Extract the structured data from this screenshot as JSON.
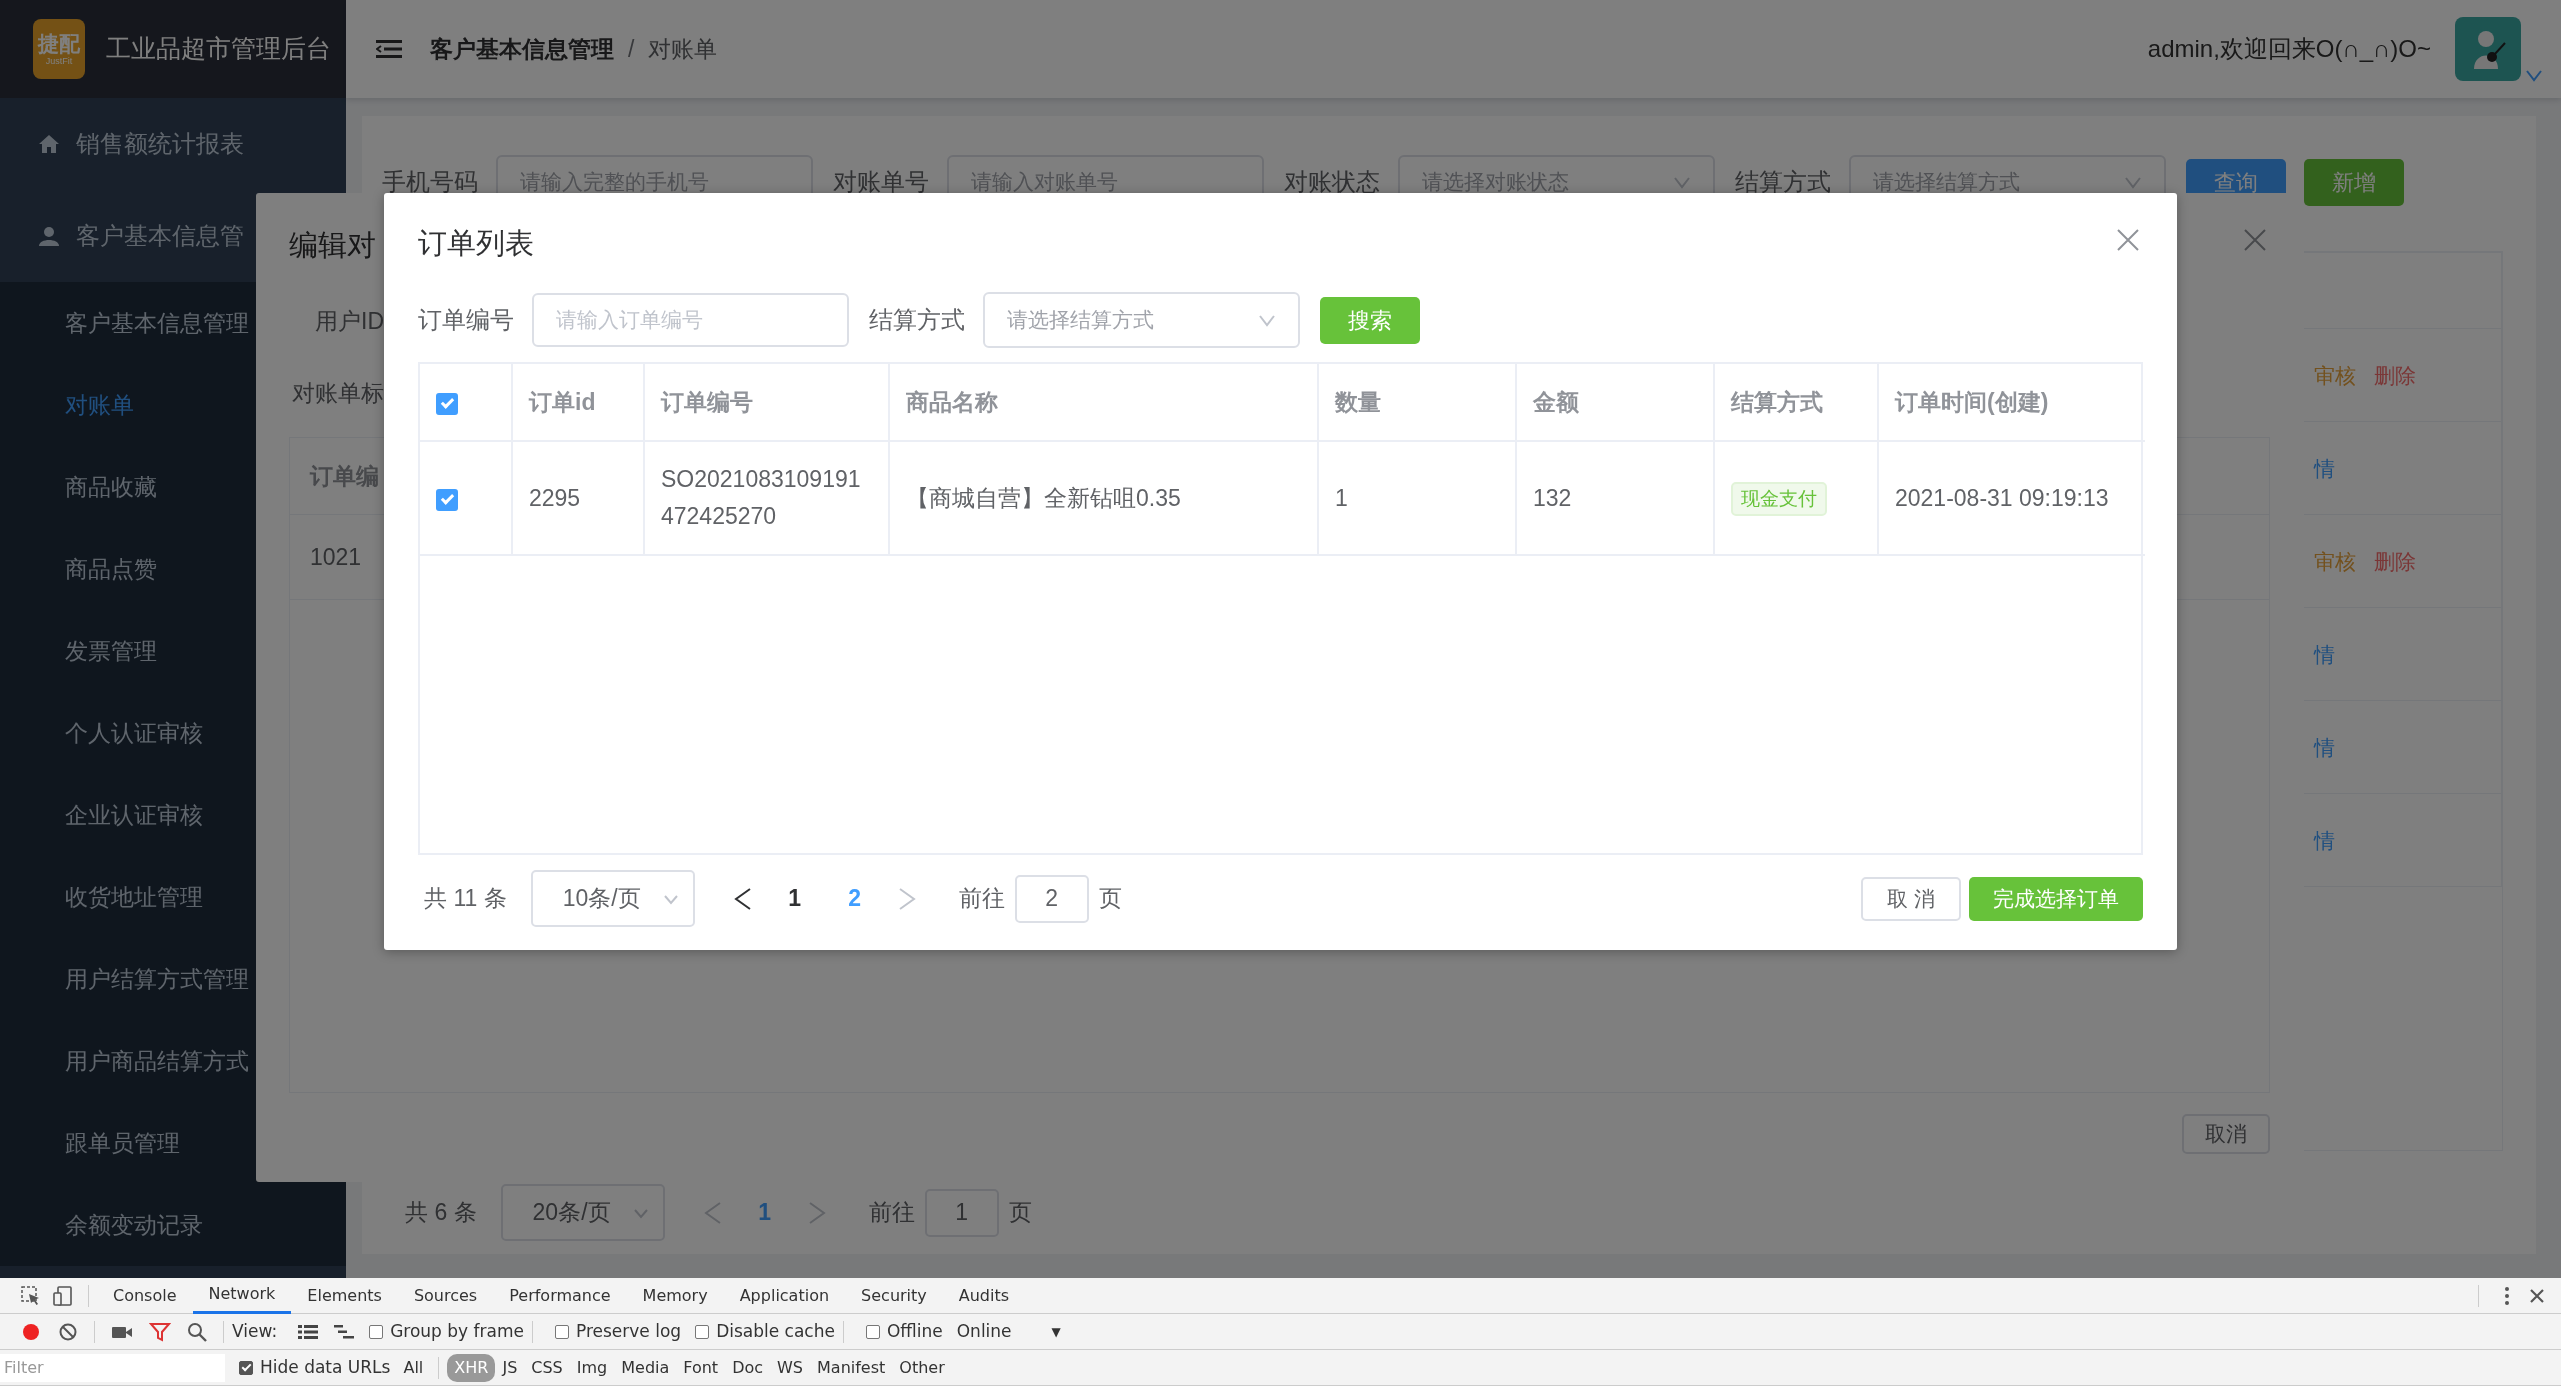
{
  "sidebar": {
    "logo_text": "捷配",
    "logo_subtext": "JustFit",
    "title": "工业品超市管理后台",
    "menu": [
      {
        "label": "销售额统计报表"
      },
      {
        "label": "客户基本信息管",
        "children": [
          {
            "label": "客户基本信息管理",
            "selected": false
          },
          {
            "label": "对账单",
            "selected": true
          },
          {
            "label": "商品收藏",
            "selected": false
          },
          {
            "label": "商品点赞",
            "selected": false
          },
          {
            "label": "发票管理",
            "selected": false
          },
          {
            "label": "个人认证审核",
            "selected": false
          },
          {
            "label": "企业认证审核",
            "selected": false
          },
          {
            "label": "收货地址管理",
            "selected": false
          },
          {
            "label": "用户结算方式管理",
            "selected": false
          },
          {
            "label": "用户商品结算方式",
            "selected": false
          },
          {
            "label": "跟单员管理",
            "selected": false
          },
          {
            "label": "余额变动记录",
            "selected": false
          }
        ]
      }
    ]
  },
  "header": {
    "breadcrumb": [
      "客户基本信息管理",
      "对账单"
    ],
    "breadcrumb_separator": "/",
    "greeting": "admin,欢迎回来O(∩_∩)O~"
  },
  "filters": [
    {
      "label": "手机号码",
      "placeholder": "请输入完整的手机号",
      "kind": "input"
    },
    {
      "label": "对账单号",
      "placeholder": "请输入对账单号",
      "kind": "input"
    },
    {
      "label": "对账状态",
      "placeholder": "请选择对账状态",
      "kind": "select"
    },
    {
      "label": "结算方式",
      "placeholder": "请选择结算方式",
      "kind": "select"
    }
  ],
  "filter_buttons": [
    {
      "label": "查询",
      "kind": "primary"
    },
    {
      "label": "新增",
      "kind": "success"
    }
  ],
  "main_table": {
    "rows": [
      {
        "actions": [
          {
            "label": "审核",
            "kind": "warning"
          },
          {
            "label": "删除",
            "kind": "danger"
          }
        ]
      },
      {
        "actions": [
          {
            "label": "情",
            "kind": "link"
          }
        ]
      },
      {
        "actions": [
          {
            "label": "审核",
            "kind": "warning"
          },
          {
            "label": "删除",
            "kind": "danger"
          }
        ]
      },
      {
        "actions": [
          {
            "label": "情",
            "kind": "link"
          }
        ]
      },
      {
        "actions": [
          {
            "label": "情",
            "kind": "link"
          }
        ]
      },
      {
        "actions": [
          {
            "label": "情",
            "kind": "link"
          }
        ]
      }
    ]
  },
  "main_pagination": {
    "total": "共 6 条",
    "page_size": "20条/页",
    "prev_disabled": true,
    "next_disabled": true,
    "pages": [
      {
        "label": "1",
        "selected": true
      }
    ],
    "goto_label": "前往",
    "goto_value": "1",
    "goto_suffix": "页"
  },
  "edit_dialog": {
    "title": "编辑对",
    "fields": [
      "用户ID",
      "对账单标"
    ],
    "table": {
      "columns": [
        "订单编"
      ],
      "rows": [
        [
          "1021"
        ]
      ]
    },
    "buttons": [
      "取消"
    ]
  },
  "order_dialog": {
    "title": "订单列表",
    "search": [
      {
        "label": "订单编号",
        "placeholder": "请输入订单编号",
        "kind": "input"
      },
      {
        "label": "结算方式",
        "placeholder": "请选择结算方式",
        "kind": "select"
      }
    ],
    "search_button": "搜索",
    "select_all_checked": true,
    "columns": [
      "订单id",
      "订单编号",
      "商品名称",
      "数量",
      "金额",
      "结算方式",
      "订单时间(创建)"
    ],
    "rows": [
      {
        "checked": true,
        "id": "2295",
        "order_no": "SO2021083109191472425270",
        "product": "【商城自营】全新钻咀0.35",
        "qty": "1",
        "amount": "132",
        "payment": "现金支付",
        "created": "2021-08-31 09:19:13"
      }
    ],
    "pagination": {
      "total": "共 11 条",
      "page_size": "10条/页",
      "prev_disabled": false,
      "next_disabled": true,
      "pages": [
        {
          "label": "1",
          "selected": false
        },
        {
          "label": "2",
          "selected": true
        }
      ],
      "goto_label": "前往",
      "goto_value": "2",
      "goto_suffix": "页"
    },
    "buttons": [
      {
        "label": "取 消",
        "kind": "default"
      },
      {
        "label": "完成选择订单",
        "kind": "success"
      }
    ]
  },
  "devtools": {
    "tabs": [
      {
        "label": "Console",
        "selected": false
      },
      {
        "label": "Network",
        "selected": true
      },
      {
        "label": "Elements",
        "selected": false
      },
      {
        "label": "Sources",
        "selected": false
      },
      {
        "label": "Performance",
        "selected": false
      },
      {
        "label": "Memory",
        "selected": false
      },
      {
        "label": "Application",
        "selected": false
      },
      {
        "label": "Security",
        "selected": false
      },
      {
        "label": "Audits",
        "selected": false
      }
    ],
    "recording": true,
    "view_label": "View:",
    "checkboxes": [
      {
        "label": "Group by frame",
        "checked": false
      },
      {
        "label": "Preserve log",
        "checked": false
      },
      {
        "label": "Disable cache",
        "checked": false
      },
      {
        "label": "Offline",
        "checked": false
      }
    ],
    "throttle": "Online",
    "throttle_caret": "▼",
    "filter_placeholder": "Filter",
    "hide_data_urls": {
      "label": "Hide data URLs",
      "checked": true
    },
    "types": [
      {
        "label": "All",
        "selected": false
      },
      {
        "label": "XHR",
        "selected": true
      },
      {
        "label": "JS",
        "selected": false
      },
      {
        "label": "CSS",
        "selected": false
      },
      {
        "label": "Img",
        "selected": false
      },
      {
        "label": "Media",
        "selected": false
      },
      {
        "label": "Font",
        "selected": false
      },
      {
        "label": "Doc",
        "selected": false
      },
      {
        "label": "WS",
        "selected": false
      },
      {
        "label": "Manifest",
        "selected": false
      },
      {
        "label": "Other",
        "selected": false
      }
    ]
  }
}
